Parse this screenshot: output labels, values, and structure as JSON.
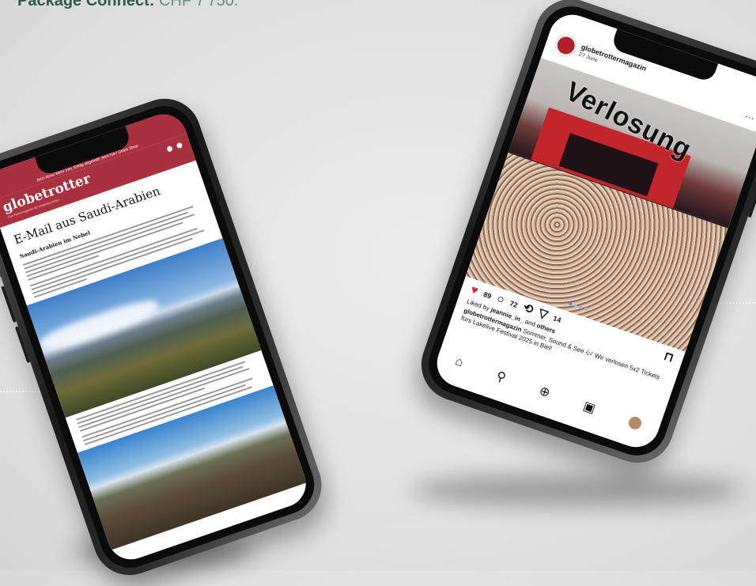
{
  "caption": {
    "brand": "Package Connect:",
    "rest": "CHF 7'750."
  },
  "email_phone": {
    "promo_bar": "Jetzt Abos! Mehr Info, Erfolg abgeholt! Jetzt hier! Globe Shop",
    "logo": "globetrotter",
    "logo_sub": "Das Reisemagazin für Weltenbummler",
    "social_icons": [
      "facebook-icon",
      "instagram-icon"
    ],
    "title": "E-Mail aus Saudi-Arabien",
    "subheading": "Saudi-Arabien im Nebel"
  },
  "instagram_phone": {
    "username": "globetrottermagazin",
    "date": "27 June",
    "overlay_text": "Verlosung",
    "likes": "89",
    "comments": "72",
    "shares": "14",
    "liked_by_prefix": "Liked by",
    "liked_by_user": "jeannie_in_",
    "liked_by_and": "and",
    "liked_by_others": "others",
    "caption_user": "globetrottermagazin",
    "caption_text": "Sommer, Sound & See 🎶 Wir verlosen 5x2 Tickets fürs Lakelive Festival 2025 in Biel!",
    "colors": {
      "brand": "#a9313d",
      "heart": "#e0243a",
      "accent": "#3897f0"
    }
  }
}
